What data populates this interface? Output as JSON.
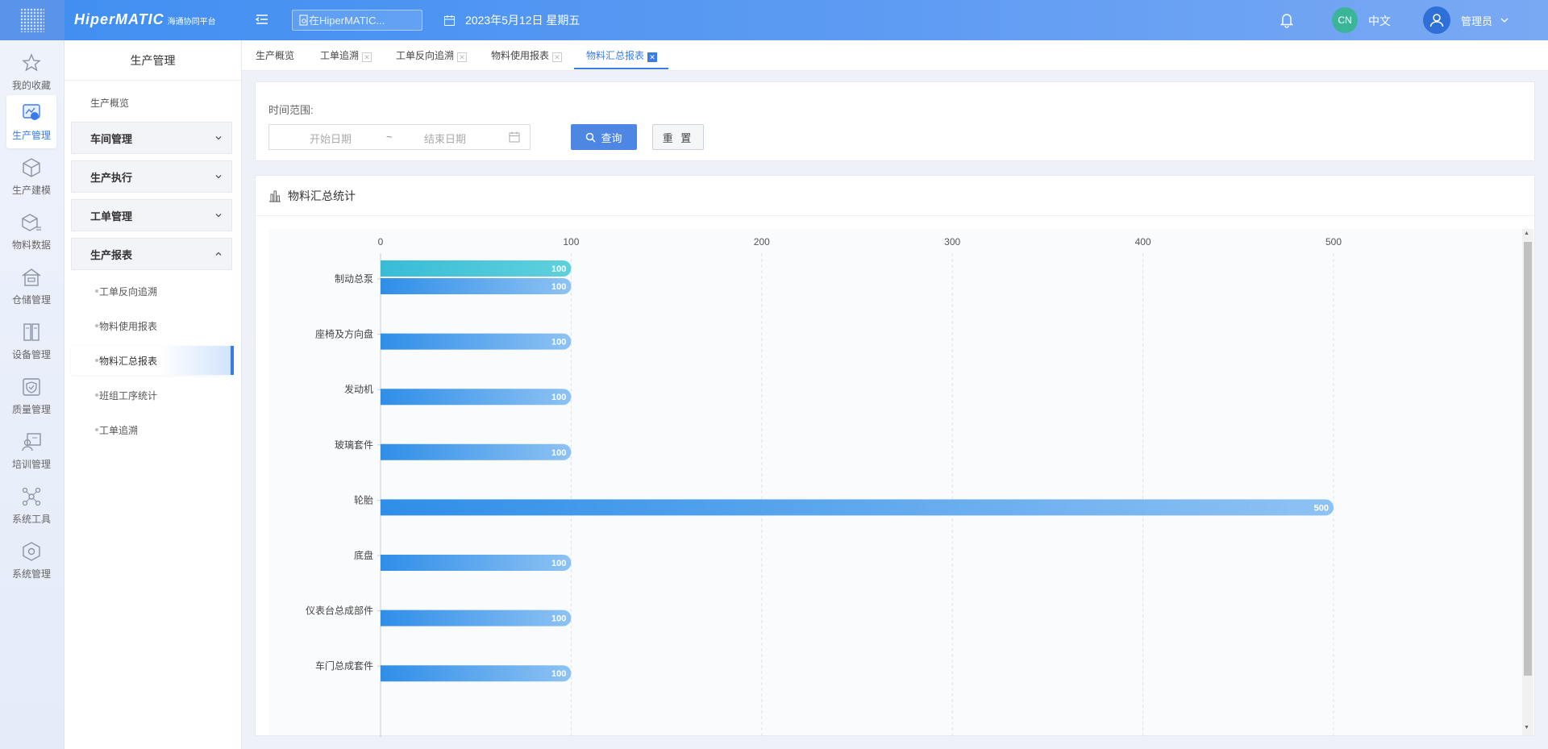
{
  "header": {
    "brand": "HiperMATIC",
    "brand_sub": "海通协同平台",
    "search_placeholder": "在HiperMATIC...",
    "date": "2023年5月12日 星期五",
    "lang_code": "CN",
    "lang_label": "中文",
    "user": "管理员"
  },
  "rail": [
    {
      "label": "我的收藏",
      "icon": "star-icon"
    },
    {
      "label": "生产管理",
      "icon": "production-icon",
      "active": true
    },
    {
      "label": "生产建模",
      "icon": "cube-icon"
    },
    {
      "label": "物料数据",
      "icon": "material-box-icon"
    },
    {
      "label": "仓储管理",
      "icon": "warehouse-icon"
    },
    {
      "label": "设备管理",
      "icon": "device-icon"
    },
    {
      "label": "质量管理",
      "icon": "shield-check-icon"
    },
    {
      "label": "培训管理",
      "icon": "training-icon"
    },
    {
      "label": "系统工具",
      "icon": "network-icon"
    },
    {
      "label": "系统管理",
      "icon": "settings-cube-icon"
    }
  ],
  "sidemenu": {
    "title": "生产管理",
    "overview": "生产概览",
    "groups": [
      {
        "label": "车间管理",
        "expanded": false
      },
      {
        "label": "生产执行",
        "expanded": false
      },
      {
        "label": "工单管理",
        "expanded": false
      },
      {
        "label": "生产报表",
        "expanded": true
      }
    ],
    "report_items": [
      "工单反向追溯",
      "物料使用报表",
      "物料汇总报表",
      "班组工序统计",
      "工单追溯"
    ],
    "active_item": "物料汇总报表"
  },
  "tabs": [
    {
      "label": "生产概览",
      "closable": false
    },
    {
      "label": "工单追溯",
      "closable": true
    },
    {
      "label": "工单反向追溯",
      "closable": true
    },
    {
      "label": "物料使用报表",
      "closable": true
    },
    {
      "label": "物料汇总报表",
      "closable": true,
      "active": true
    }
  ],
  "filter": {
    "label": "时间范围:",
    "start_placeholder": "开始日期",
    "separator": "~",
    "end_placeholder": "结束日期",
    "query_label": "查询",
    "reset_label": "重 置"
  },
  "card": {
    "title": "物料汇总统计"
  },
  "colors": {
    "primary": "#4e86e3",
    "bar_blue_start": "#2f8ee8",
    "bar_blue_end": "#8ec2f3",
    "bar_teal_start": "#38bcd6",
    "bar_teal_end": "#5fd1dd"
  },
  "chart_data": {
    "type": "bar",
    "orientation": "horizontal",
    "xlim": [
      0,
      500
    ],
    "xticks": [
      0,
      100,
      200,
      300,
      400,
      500
    ],
    "x_axis_position": "top",
    "grid": true,
    "categories": [
      "制动总泵",
      "座椅及方向盘",
      "发动机",
      "玻璃套件",
      "轮胎",
      "底盘",
      "仪表台总成部件",
      "车门总成套件"
    ],
    "series": [
      {
        "color_key": "teal",
        "values": [
          100,
          null,
          null,
          null,
          null,
          null,
          null,
          null
        ]
      },
      {
        "color_key": "blue",
        "values": [
          100,
          100,
          100,
          100,
          500,
          100,
          100,
          100
        ]
      }
    ]
  }
}
